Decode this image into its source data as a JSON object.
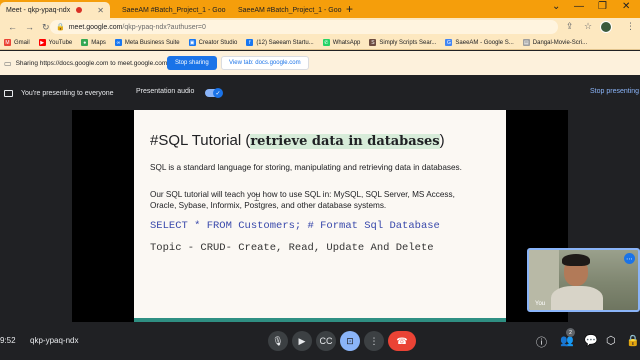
{
  "tabs": [
    {
      "title": "Meet - qkp-ypaq-ndx",
      "active": true
    },
    {
      "title": "SaeeAM #Batch_Project_1 - Goo",
      "active": false
    },
    {
      "title": "SaeeAM #Batch_Project_1 - Goo",
      "active": false
    }
  ],
  "address": {
    "host": "meet.google.com",
    "path": "/qkp-ypaq-ndx?authuser=0"
  },
  "bookmarks": [
    {
      "label": "Gmail",
      "color": "#ea4335"
    },
    {
      "label": "YouTube",
      "color": "#ff0000"
    },
    {
      "label": "Maps",
      "color": "#34a853"
    },
    {
      "label": "Meta Business Suite",
      "color": "#1877f2"
    },
    {
      "label": "Creator Studio",
      "color": "#1877f2"
    },
    {
      "label": "(12) Saeeam Startu...",
      "color": "#1877f2"
    },
    {
      "label": "WhatsApp",
      "color": "#25d366"
    },
    {
      "label": "Simply Scripts Sear...",
      "color": "#6d4c41"
    },
    {
      "label": "SaeeAM - Google S...",
      "color": "#4285f4"
    },
    {
      "label": "Dangal-Movie-Scri...",
      "color": "#9e9e9e"
    }
  ],
  "share_bar": {
    "text": "Sharing https://docs.google.com to meet.google.com",
    "stop_label": "Stop sharing",
    "view_label": "View tab: docs.google.com"
  },
  "present_bar": {
    "text": "You're presenting to everyone",
    "audio_label": "Presentation audio",
    "stop_label": "Stop presenting"
  },
  "slide": {
    "title_prefix": "#SQL Tutorial (",
    "title_highlight": "retrieve data in databases",
    "title_suffix": ")",
    "para1": "SQL is a standard language for storing, manipulating and retrieving data in databases.",
    "para2": "Our SQL tutorial will teach you how to use SQL in: MySQL, SQL Server, MS Access, Oracle, Sybase, Informix, Postgres, and other database systems.",
    "code1": "SELECT * FROM Customers; # Format Sql Database",
    "code2": "Topic - CRUD- Create, Read, Update And Delete"
  },
  "self_view": {
    "label": "You"
  },
  "bottom": {
    "clock": "9:52",
    "meeting_code": "qkp-ypaq-ndx",
    "people_count": "2"
  },
  "colors": {
    "accent": "#1a73e8",
    "leave": "#ea4335",
    "tab_strip": "#f59e0b"
  }
}
